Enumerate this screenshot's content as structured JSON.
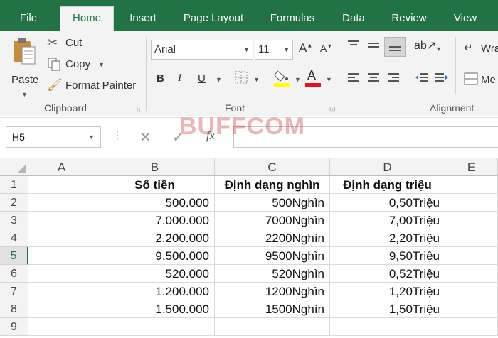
{
  "ribbon_tabs": [
    "File",
    "Home",
    "Insert",
    "Page Layout",
    "Formulas",
    "Data",
    "Review",
    "View"
  ],
  "clipboard": {
    "paste": "Paste",
    "cut": "Cut",
    "copy": "Copy",
    "format_painter": "Format Painter",
    "label": "Clipboard"
  },
  "font": {
    "name": "Arial",
    "size": "11",
    "label": "Font",
    "bold": "B",
    "italic": "I",
    "underline": "U"
  },
  "alignment": {
    "wrap": "Wra",
    "merge": "Me",
    "label": "Alignment"
  },
  "formula_bar": {
    "name_box": "H5",
    "fx": "fx",
    "value": ""
  },
  "watermark": "BUFFCOM",
  "columns": [
    "A",
    "B",
    "C",
    "D",
    "E"
  ],
  "rows": [
    "1",
    "2",
    "3",
    "4",
    "5",
    "6",
    "7",
    "8",
    "9"
  ],
  "selected_row": "5",
  "sheet": {
    "headers": [
      "Số tiền",
      "Định dạng nghìn",
      "Định dạng triệu"
    ],
    "data": [
      [
        "500.000",
        "500Nghìn",
        "0,50Triệu"
      ],
      [
        "7.000.000",
        "7000Nghìn",
        "7,00Triệu"
      ],
      [
        "2.200.000",
        "2200Nghìn",
        "2,20Triệu"
      ],
      [
        "9.500.000",
        "9500Nghìn",
        "9,50Triệu"
      ],
      [
        "520.000",
        "520Nghìn",
        "0,52Triệu"
      ],
      [
        "1.200.000",
        "1200Nghìn",
        "1,20Triệu"
      ],
      [
        "1.500.000",
        "1500Nghìn",
        "1,50Triệu"
      ]
    ]
  },
  "colors": {
    "excel_green": "#217346",
    "font_color_bar": "#e81123",
    "fill_color_bar": "#ffff00"
  }
}
